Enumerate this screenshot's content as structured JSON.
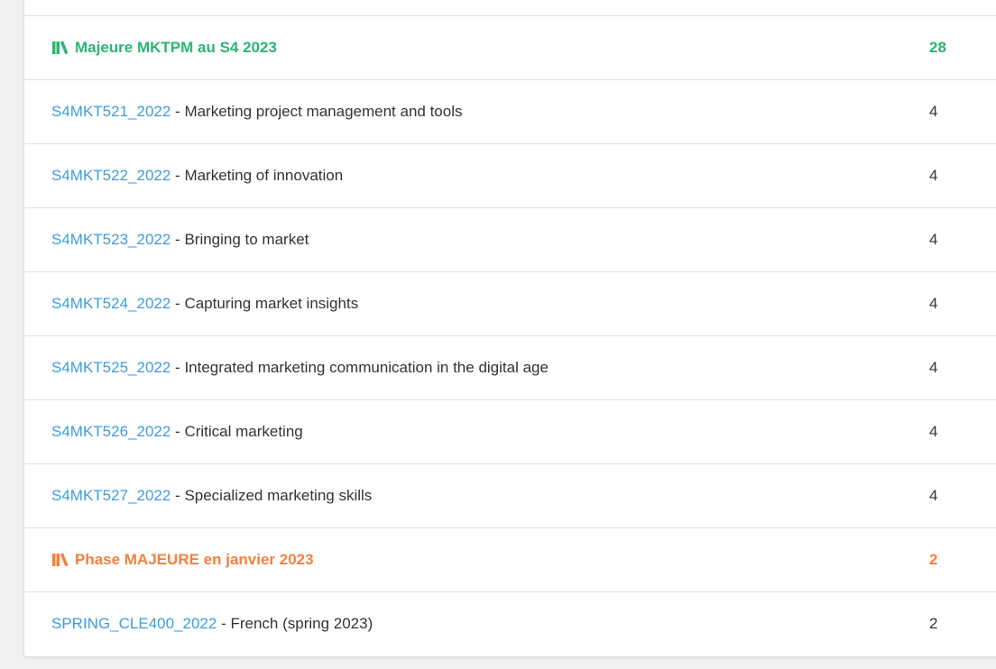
{
  "colors": {
    "group_green": "#2bb673",
    "group_orange": "#f5803e",
    "link": "#3b9de0",
    "text": "#333333"
  },
  "groups": [
    {
      "icon": "books-icon",
      "title": "Majeure MKTPM au S4 2023",
      "credits": "28",
      "color": "green",
      "courses": [
        {
          "code": "S4MKT521_2022",
          "separator": " - ",
          "name": "Marketing project management and tools",
          "credits": "4"
        },
        {
          "code": "S4MKT522_2022",
          "separator": " - ",
          "name": "Marketing of innovation",
          "credits": "4"
        },
        {
          "code": "S4MKT523_2022",
          "separator": " - ",
          "name": "Bringing to market",
          "credits": "4"
        },
        {
          "code": "S4MKT524_2022",
          "separator": " - ",
          "name": "Capturing market insights",
          "credits": "4"
        },
        {
          "code": "S4MKT525_2022",
          "separator": " - ",
          "name": "Integrated marketing communication in the digital age",
          "credits": "4"
        },
        {
          "code": "S4MKT526_2022",
          "separator": " - ",
          "name": "Critical marketing",
          "credits": "4"
        },
        {
          "code": "S4MKT527_2022",
          "separator": " - ",
          "name": "Specialized marketing skills",
          "credits": "4"
        }
      ]
    },
    {
      "icon": "books-icon",
      "title": "Phase MAJEURE en janvier 2023",
      "credits": "2",
      "color": "orange",
      "courses": [
        {
          "code": "SPRING_CLE400_2022",
          "separator": " - ",
          "name": "French (spring 2023)",
          "credits": "2"
        }
      ]
    }
  ]
}
